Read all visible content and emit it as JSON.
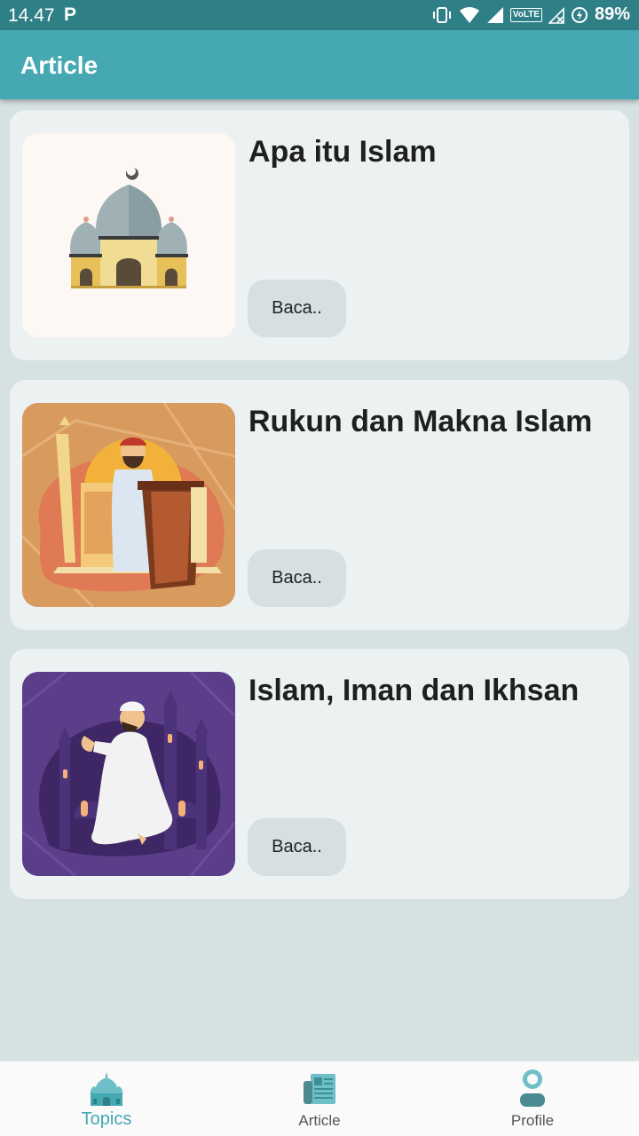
{
  "status_bar": {
    "time": "14.47",
    "app_icon_letter": "P",
    "volte": "VoLTE",
    "battery": "89%"
  },
  "app_bar": {
    "title": "Article"
  },
  "articles": [
    {
      "title": "Apa itu Islam",
      "button": "Baca..",
      "image_icon": "mosque-illustration-icon"
    },
    {
      "title": "Rukun dan Makna Islam",
      "button": "Baca..",
      "image_icon": "preacher-at-pulpit-illustration-icon"
    },
    {
      "title": "Islam, Iman dan Ikhsan",
      "button": "Baca..",
      "image_icon": "man-praying-illustration-icon"
    }
  ],
  "bottom_nav": {
    "items": [
      {
        "label": "Topics",
        "icon": "mosque-icon",
        "active": true
      },
      {
        "label": "Article",
        "icon": "newspaper-icon",
        "active": false
      },
      {
        "label": "Profile",
        "icon": "person-icon",
        "active": false
      }
    ]
  },
  "colors": {
    "status_bar": "#2f7f86",
    "app_bar": "#45a8b3",
    "background": "#d6e1e2",
    "card": "#ecf1f2",
    "button": "#d6e0e1",
    "active_nav": "#45a8b3"
  }
}
